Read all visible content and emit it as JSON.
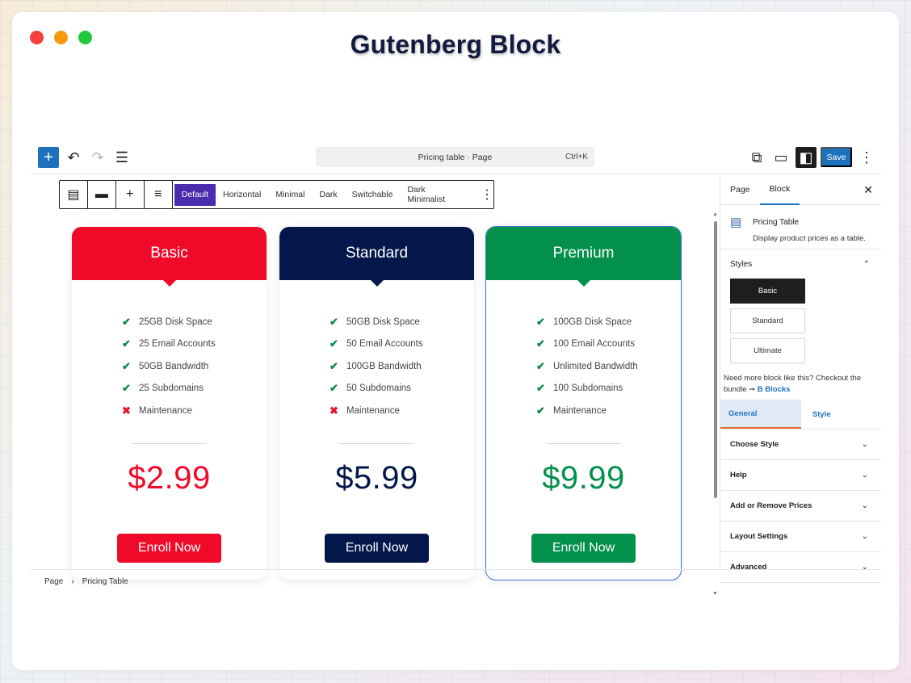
{
  "hero": {
    "title": "Gutenberg Block"
  },
  "topbar": {
    "add_icon": "+",
    "undo_icon": "↶",
    "redo_icon": "↷",
    "list_icon": "☰",
    "command": "Pricing table · Page",
    "shortcut": "Ctrl+K",
    "external_icon": "⧉",
    "desktop_icon": "▭",
    "panel_icon": "◧",
    "save_label": "Save",
    "more_icon": "⋮"
  },
  "block_toolbar": {
    "icons": [
      "▤",
      "▬",
      "+",
      "≡"
    ],
    "tabs": [
      "Default",
      "Horizontal",
      "Minimal",
      "Dark",
      "Switchable",
      "Dark Minimalist"
    ],
    "active_tab": "Default",
    "more_icon": "⋮"
  },
  "cards": [
    {
      "name": "Basic",
      "color": "#ef0a2a",
      "features": [
        {
          "text": "25GB Disk Space",
          "ok": true
        },
        {
          "text": "25 Email Accounts",
          "ok": true
        },
        {
          "text": "50GB Bandwidth",
          "ok": true
        },
        {
          "text": "25 Subdomains",
          "ok": true
        },
        {
          "text": "Maintenance",
          "ok": false
        }
      ],
      "price": "$2.99",
      "button": "Enroll Now"
    },
    {
      "name": "Standard",
      "color": "#03174a",
      "features": [
        {
          "text": "50GB Disk Space",
          "ok": true
        },
        {
          "text": "50 Email Accounts",
          "ok": true
        },
        {
          "text": "100GB Bandwidth",
          "ok": true
        },
        {
          "text": "50 Subdomains",
          "ok": true
        },
        {
          "text": "Maintenance",
          "ok": false
        }
      ],
      "price": "$5.99",
      "button": "Enroll Now"
    },
    {
      "name": "Premium",
      "color": "#03904b",
      "features": [
        {
          "text": "100GB Disk Space",
          "ok": true
        },
        {
          "text": "100 Email Accounts",
          "ok": true
        },
        {
          "text": "Unlimited Bandwidth",
          "ok": true
        },
        {
          "text": "100 Subdomains",
          "ok": true
        },
        {
          "text": "Maintenance",
          "ok": true
        }
      ],
      "price": "$9.99",
      "button": "Enroll Now"
    }
  ],
  "breadcrumb": {
    "root": "Page",
    "sep": "›",
    "current": "Pricing Table"
  },
  "sidebar": {
    "tabs": [
      "Page",
      "Block"
    ],
    "close_icon": "✕",
    "block_icon": "▤",
    "block_name": "Pricing Table",
    "block_desc": "Display product prices as a table.",
    "styles_label": "Styles",
    "styles_chevron": "⌃",
    "styles": [
      "Basic",
      "Standard",
      "Ultimate"
    ],
    "note": "Need more block like this? Checkout the bundle",
    "note_arrow": "➞",
    "note_link": "B Blocks",
    "gen_tabs": [
      "General",
      "Style"
    ],
    "panels": [
      "Choose Style",
      "Help",
      "Add or Remove Prices",
      "Layout Settings",
      "Advanced"
    ],
    "panel_chevron": "⌄"
  }
}
